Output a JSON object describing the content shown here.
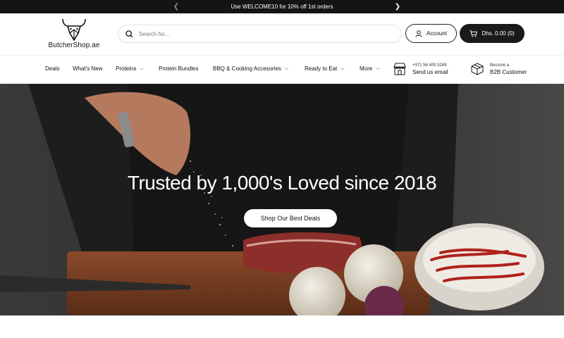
{
  "announcement": {
    "text": "Use WELCOME10 for 10% off 1st orders",
    "prev_icon": "chevron-left-icon",
    "next_icon": "chevron-right-icon"
  },
  "header": {
    "logo_text": "ButcherShop.ae",
    "search_placeholder": "Search for...",
    "account_label": "Account",
    "cart_label": "Dhs. 0.00 (0)"
  },
  "nav": {
    "items": [
      {
        "label": "Deals"
      },
      {
        "label": "What's New"
      },
      {
        "label": "Proteins"
      },
      {
        "label": "Protein Bundles"
      },
      {
        "label": "BBQ & Cooking Accesories"
      },
      {
        "label": "Ready to Eat"
      },
      {
        "label": "More"
      }
    ],
    "contact": {
      "phone": "+971 56 400 5268",
      "label": "Send us email"
    },
    "b2b": {
      "top": "Become a",
      "label": "B2B Customer"
    }
  },
  "hero": {
    "title": "Trusted by 1,000's Loved since 2018",
    "cta": "Shop Our Best Deals"
  },
  "colors": {
    "announcement_bg": "#141414",
    "cart_bg": "#1a1a1a",
    "accent": "#111111"
  }
}
